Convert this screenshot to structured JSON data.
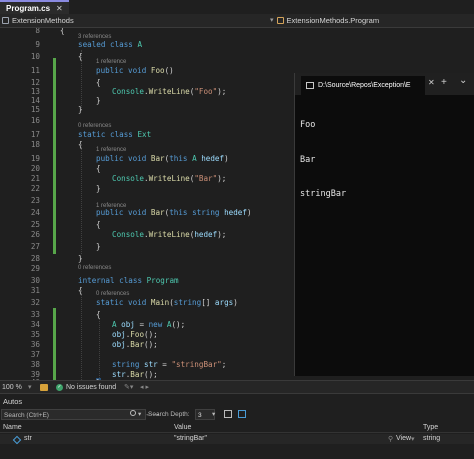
{
  "tabs": [
    {
      "label": "Program.cs",
      "close": "✕"
    }
  ],
  "navbar": {
    "project": "ExtensionMethods",
    "type_scope": "ExtensionMethods.Program"
  },
  "editor": {
    "lines": [
      {
        "n": "8",
        "text": "{"
      },
      {
        "n": "9",
        "text": "sealed class A"
      },
      {
        "n": "10",
        "text": "{"
      },
      {
        "n": "11",
        "text": "public void Foo()"
      },
      {
        "n": "12",
        "text": "{"
      },
      {
        "n": "13",
        "text": "Console.WriteLine(\"Foo\");"
      },
      {
        "n": "14",
        "text": "}"
      },
      {
        "n": "15",
        "text": "}"
      },
      {
        "n": "16",
        "text": ""
      },
      {
        "n": "17",
        "text": "static class Ext"
      },
      {
        "n": "18",
        "text": "{"
      },
      {
        "n": "19",
        "text": "public void Bar(this A hedef)"
      },
      {
        "n": "20",
        "text": "{"
      },
      {
        "n": "21",
        "text": "Console.WriteLine(\"Bar\");"
      },
      {
        "n": "22",
        "text": "}"
      },
      {
        "n": "23",
        "text": ""
      },
      {
        "n": "24",
        "text": "public void Bar(this string hedef)"
      },
      {
        "n": "25",
        "text": "{"
      },
      {
        "n": "26",
        "text": "Console.WriteLine(hedef);"
      },
      {
        "n": "27",
        "text": "}"
      },
      {
        "n": "28",
        "text": "}"
      },
      {
        "n": "29",
        "text": ""
      },
      {
        "n": "30",
        "text": "internal class Program"
      },
      {
        "n": "31",
        "text": "{"
      },
      {
        "n": "32",
        "text": "static void Main(string[] args)"
      },
      {
        "n": "33",
        "text": "{"
      },
      {
        "n": "34",
        "text": "A obj = new A();"
      },
      {
        "n": "35",
        "text": "obj.Foo();"
      },
      {
        "n": "36",
        "text": "obj.Bar();"
      },
      {
        "n": "37",
        "text": ""
      },
      {
        "n": "38",
        "text": "string str = \"stringBar\";"
      },
      {
        "n": "39",
        "text": "str.Bar();"
      },
      {
        "n": "40",
        "text": "}"
      }
    ],
    "lens": {
      "class_a": "3 references",
      "foo": "1 reference",
      "ext": "0 references",
      "bar_a": "1 reference",
      "bar_string": "1 reference",
      "program": "0 references",
      "main": "0 references"
    }
  },
  "console": {
    "title": "D:\\Source\\Repos\\Exception\\E",
    "close": "✕",
    "new_tab": "+",
    "dropdown": "⌄",
    "output": [
      "Foo",
      "Bar",
      "stringBar"
    ]
  },
  "status": {
    "zoom": "100 %",
    "issues": "No issues found"
  },
  "autos": {
    "title": "Autos",
    "search_placeholder": "Search (Ctrl+E)",
    "search_depth_label": "Search Depth:",
    "search_depth_value": "3",
    "columns": {
      "name": "Name",
      "value": "Value",
      "type": "Type"
    },
    "rows": [
      {
        "name": "str",
        "value": "\"stringBar\"",
        "view": "View",
        "type": "string"
      }
    ]
  },
  "colors": {
    "keyword": "#569cd6",
    "type": "#4ec9b0",
    "method": "#dcdcaa",
    "string": "#ce9178",
    "change_bar": "#57a64a"
  }
}
